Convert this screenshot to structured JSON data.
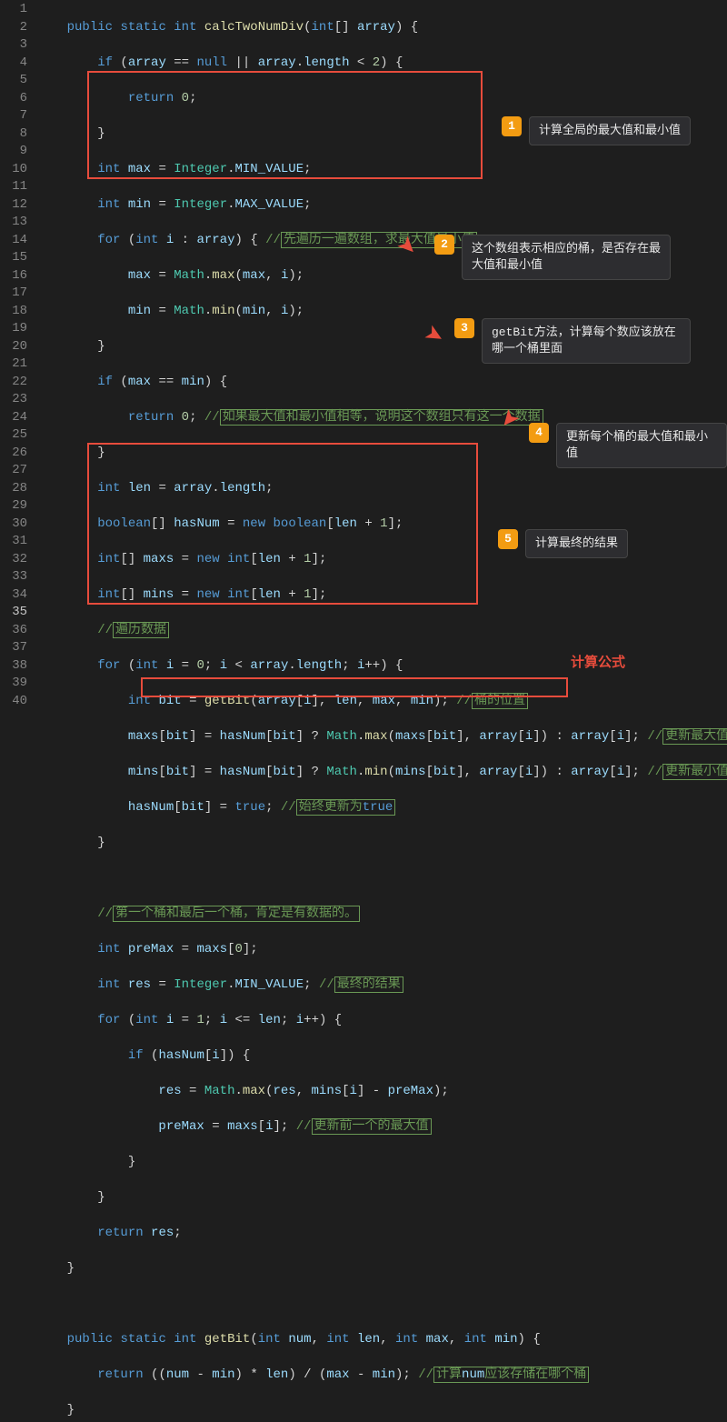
{
  "gutter": {
    "total": 40,
    "active": 35
  },
  "code": {
    "l1": {
      "p1": "public",
      "p2": "static",
      "p3": "int",
      "p4": "calcTwoNumDiv",
      "p5": "int",
      "p6": "array"
    },
    "l2": {
      "p1": "if",
      "p2": "array",
      "p3": "null",
      "p4": "array",
      "p5": "length",
      "p6": "2"
    },
    "l3": {
      "p1": "return",
      "p2": "0"
    },
    "l5": {
      "p1": "int",
      "p2": "max",
      "p3": "Integer",
      "p4": "MIN_VALUE"
    },
    "l6": {
      "p1": "int",
      "p2": "min",
      "p3": "Integer",
      "p4": "MAX_VALUE"
    },
    "l7": {
      "p1": "for",
      "p2": "int",
      "p3": "i",
      "p4": "array",
      "c1": "先遍历一遍数组，求最大值最小值"
    },
    "l8": {
      "p1": "max",
      "p2": "Math",
      "p3": "max",
      "p4": "max",
      "p5": "i"
    },
    "l9": {
      "p1": "min",
      "p2": "Math",
      "p3": "min",
      "p4": "min",
      "p5": "i"
    },
    "l11": {
      "p1": "if",
      "p2": "max",
      "p3": "min"
    },
    "l12": {
      "p1": "return",
      "p2": "0",
      "c1": "如果最大值和最小值相等，说明这个数组只有这一个数据"
    },
    "l14": {
      "p1": "int",
      "p2": "len",
      "p3": "array",
      "p4": "length"
    },
    "l15": {
      "p1": "boolean",
      "p2": "hasNum",
      "p3": "new",
      "p4": "boolean",
      "p5": "len",
      "p6": "1"
    },
    "l16": {
      "p1": "int",
      "p2": "maxs",
      "p3": "new",
      "p4": "int",
      "p5": "len",
      "p6": "1"
    },
    "l17": {
      "p1": "int",
      "p2": "mins",
      "p3": "new",
      "p4": "int",
      "p5": "len",
      "p6": "1"
    },
    "l18": {
      "c1": "遍历数据"
    },
    "l19": {
      "p1": "for",
      "p2": "int",
      "p3": "i",
      "p4": "0",
      "p5": "i",
      "p6": "array",
      "p7": "length",
      "p8": "i"
    },
    "l20": {
      "p1": "int",
      "p2": "bit",
      "p3": "getBit",
      "p4": "array",
      "p5": "i",
      "p6": "len",
      "p7": "max",
      "p8": "min",
      "c1": "桶的位置"
    },
    "l21": {
      "p1": "maxs",
      "p2": "bit",
      "p3": "hasNum",
      "p4": "bit",
      "p5": "Math",
      "p6": "max",
      "p7": "maxs",
      "p8": "bit",
      "p9": "array",
      "p10": "i",
      "p11": "array",
      "p12": "i",
      "c1": "更新最大值"
    },
    "l22": {
      "p1": "mins",
      "p2": "bit",
      "p3": "hasNum",
      "p4": "bit",
      "p5": "Math",
      "p6": "min",
      "p7": "mins",
      "p8": "bit",
      "p9": "array",
      "p10": "i",
      "p11": "array",
      "p12": "i",
      "c1": "更新最小值"
    },
    "l23": {
      "p1": "hasNum",
      "p2": "bit",
      "p3": "true",
      "c1": "始终更新为",
      "c2": "true"
    },
    "l26": {
      "c1": "第一个桶和最后一个桶，肯定是有数据的。"
    },
    "l27": {
      "p1": "int",
      "p2": "preMax",
      "p3": "maxs",
      "p4": "0"
    },
    "l28": {
      "p1": "int",
      "p2": "res",
      "p3": "Integer",
      "p4": "MIN_VALUE",
      "c1": "最终的结果"
    },
    "l29": {
      "p1": "for",
      "p2": "int",
      "p3": "i",
      "p4": "1",
      "p5": "i",
      "p6": "len",
      "p7": "i"
    },
    "l30": {
      "p1": "if",
      "p2": "hasNum",
      "p3": "i"
    },
    "l31": {
      "p1": "res",
      "p2": "Math",
      "p3": "max",
      "p4": "res",
      "p5": "mins",
      "p6": "i",
      "p7": "preMax"
    },
    "l32": {
      "p1": "preMax",
      "p2": "maxs",
      "p3": "i",
      "c1": "更新前一个的最大值"
    },
    "l35": {
      "p1": "return",
      "p2": "res"
    },
    "l38": {
      "p1": "public",
      "p2": "static",
      "p3": "int",
      "p4": "getBit",
      "p5": "int",
      "p6": "num",
      "p7": "int",
      "p8": "len",
      "p9": "int",
      "p10": "max",
      "p11": "int",
      "p12": "min"
    },
    "l39": {
      "p1": "return",
      "p2": "num",
      "p3": "min",
      "p4": "len",
      "p5": "max",
      "p6": "min",
      "c1": "计算",
      "c2": "num",
      "c3": "应该存储在哪个桶"
    }
  },
  "annotations": {
    "a1": {
      "num": "1",
      "text": "计算全局的最大值和最小值"
    },
    "a2": {
      "num": "2",
      "text": "这个数组表示相应的桶，是否存在最大值和最小值"
    },
    "a3": {
      "num": "3",
      "text": "getBit方法，计算每个数应该放在哪一个桶里面"
    },
    "a4": {
      "num": "4",
      "text": "更新每个桶的最大值和最小值"
    },
    "a5": {
      "num": "5",
      "text": "计算最终的结果"
    },
    "formula": "计算公式"
  }
}
